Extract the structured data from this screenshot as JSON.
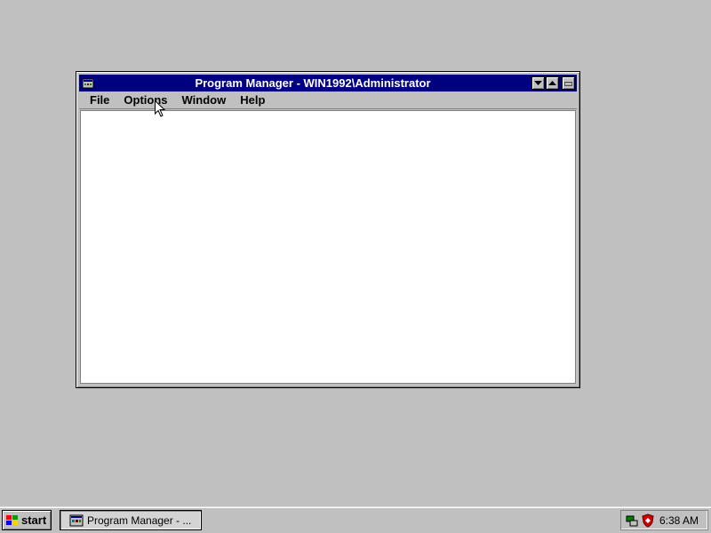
{
  "window": {
    "title": "Program Manager - WIN1992\\Administrator",
    "menu": [
      "File",
      "Options",
      "Window",
      "Help"
    ]
  },
  "taskbar": {
    "start_label": "start",
    "task_label": "Program Manager - ...",
    "clock": "6:38 AM"
  },
  "icons": {
    "system_menu": "program-manager-icon",
    "minimize": "triangle-down-icon",
    "maximize": "triangle-up-icon",
    "restore": "restore-icon",
    "start": "windows-flag-icon",
    "tray": [
      "network-icon",
      "shield-icon"
    ]
  },
  "colors": {
    "desktop": "#c0c0c0",
    "titlebar": "#000080",
    "client": "#ffffff"
  }
}
